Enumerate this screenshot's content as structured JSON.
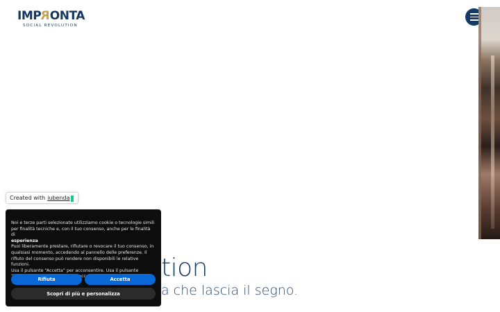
{
  "header": {
    "logo": {
      "wordmark_pre": "IMP",
      "wordmark_r": "R",
      "wordmark_post": "ONTA",
      "tagline": "SOCIAL REVOLUTION"
    },
    "menu_icon": "hamburger-icon"
  },
  "hero": {
    "headline": "tion",
    "subline": "a che lascia il segno."
  },
  "iubenda_badge": {
    "prefix": "Created with",
    "link": "iubenda"
  },
  "cookie_banner": {
    "line1": "Noi e terze parti selezionate utilizziamo cookie o tecnologie simili per finalità tecniche e, con il tuo consenso, anche per le finalità di",
    "line1_bold": "esperienza",
    "line2": "Puoi liberamente prestare, rifiutare o revocare il tuo consenso, in qualsiasi momento, accedendo al pannello delle preferenze. Il rifiuto del consenso può rendere non disponibili le relative funzioni.",
    "line3": "Usa il pulsante “Accetta” per acconsentire. Usa il pulsante “Rifiuta” per continuare senza accettare.",
    "reject_label": "Rifiuta",
    "accept_label": "Accetta",
    "more_label": "Scopri di più e personalizza"
  },
  "colors": {
    "brand_navy": "#153a66",
    "brand_gold": "#c8a24a",
    "button_blue": "#0a68d6",
    "banner_bg": "#0d0d0d"
  }
}
